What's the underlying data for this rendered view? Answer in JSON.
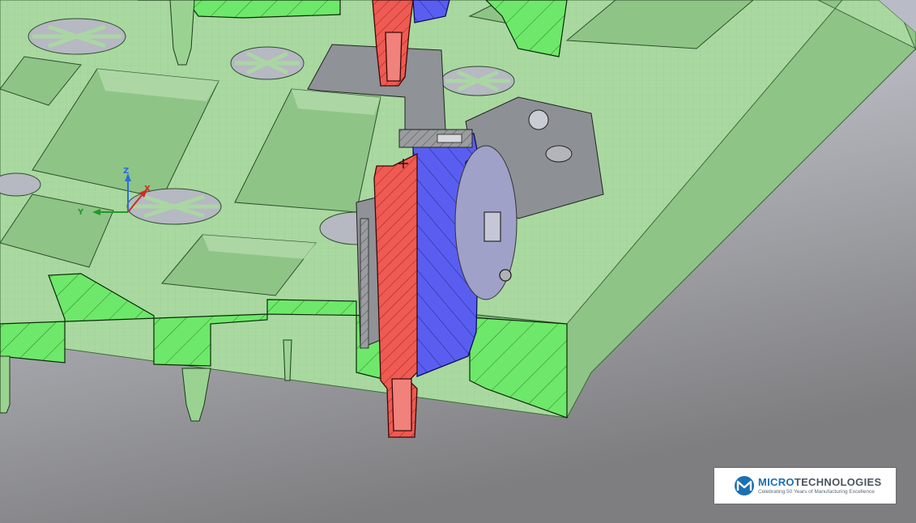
{
  "axis_triad": {
    "x_label": "X",
    "y_label": "Y",
    "z_label": "Z"
  },
  "logo": {
    "name_accent": "MICRO",
    "name_rest": "TECHNOLOGIES",
    "tagline": "Celebrating 50 Years of Manufacturing Excellence"
  },
  "colors": {
    "background_top": "#d7d9e2",
    "background_bottom": "#808080",
    "mold_plate": "#a9d9a0",
    "mold_plate_shadow": "#7fb27a",
    "section_cut": "#6ee86a",
    "core_red": "#ef5a52",
    "cavity_blue": "#5a5ef0",
    "insert_grey": "#8f9296",
    "brand_blue": "#1a6fb5"
  }
}
